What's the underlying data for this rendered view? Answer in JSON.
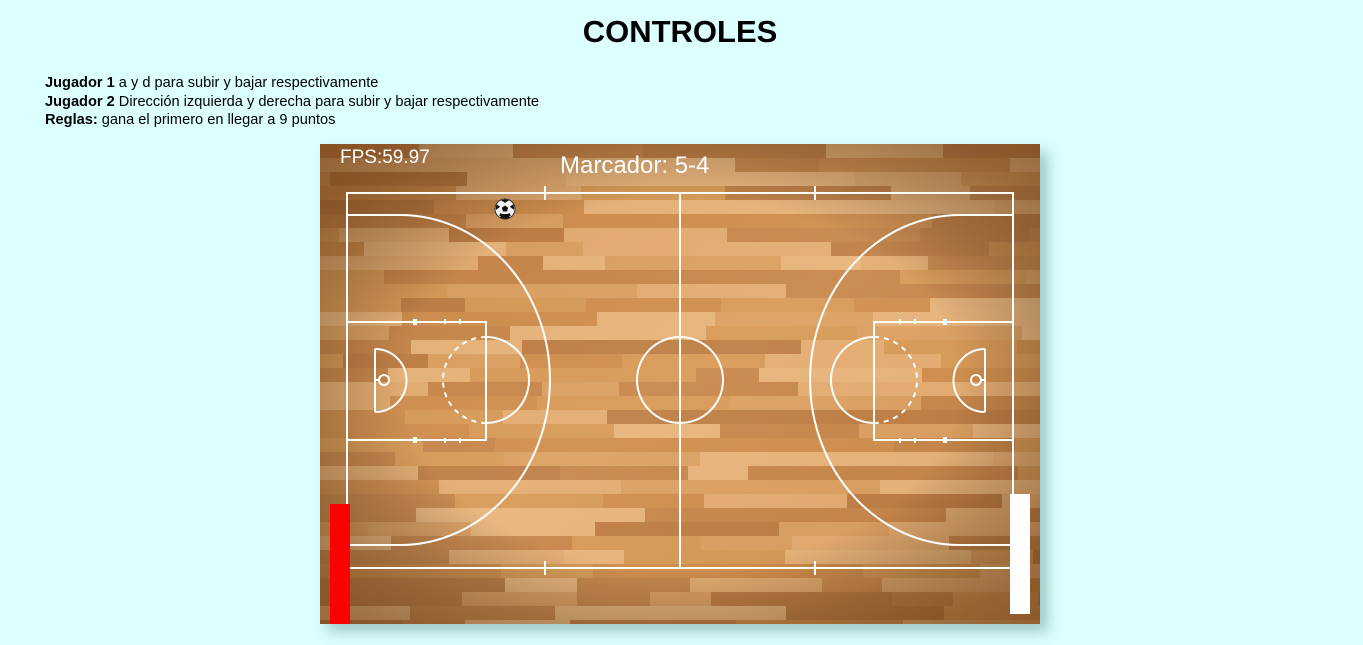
{
  "header": {
    "title": "CONTROLES"
  },
  "instructions": {
    "player1_label": "Jugador 1",
    "player1_text": " a y d para subir y bajar respectivamente",
    "player2_label": "Jugador 2",
    "player2_text": " Dirección izquierda y derecha para subir y bajar respectivamente",
    "rules_label": "Reglas:",
    "rules_text": " gana el primero en llegar a 9 puntos"
  },
  "game": {
    "fps_text": "FPS:59.97",
    "score_text": "Marcador: 5-4",
    "player1_paddle_color": "#ff0000",
    "player2_paddle_color": "#ffffff",
    "ball_icon": "soccer-ball-icon",
    "court_color": "#d9a066"
  }
}
